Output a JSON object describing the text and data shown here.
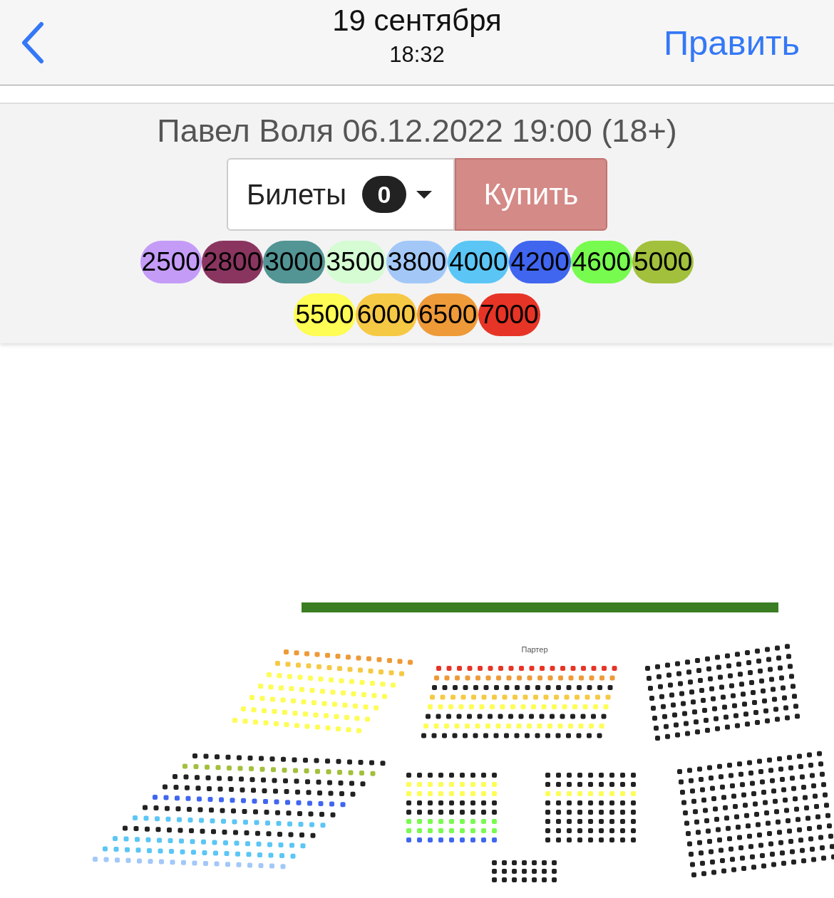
{
  "nav": {
    "title": "19 сентября",
    "subtitle": "18:32",
    "action": "Править"
  },
  "event": {
    "title": "Павел Воля 06.12.2022 19:00 (18+)"
  },
  "tickets": {
    "label": "Билеты",
    "count": "0",
    "buy": "Купить"
  },
  "prices": [
    {
      "label": "2500",
      "color": "#c49cf8"
    },
    {
      "label": "2800",
      "color": "#8a3560"
    },
    {
      "label": "3000",
      "color": "#539494"
    },
    {
      "label": "3500",
      "color": "#d5fcd3"
    },
    {
      "label": "3800",
      "color": "#a3c8f8"
    },
    {
      "label": "4000",
      "color": "#5bc6f5"
    },
    {
      "label": "4200",
      "color": "#4066f0"
    },
    {
      "label": "4600",
      "color": "#78fb4f"
    },
    {
      "label": "5000",
      "color": "#a2c03c"
    },
    {
      "label": "5500",
      "color": "#fdfd55"
    },
    {
      "label": "6000",
      "color": "#f6c945"
    },
    {
      "label": "6500",
      "color": "#ee9a38"
    },
    {
      "label": "7000",
      "color": "#e63426"
    }
  ],
  "seat_map": {
    "section_label": "Партер"
  }
}
